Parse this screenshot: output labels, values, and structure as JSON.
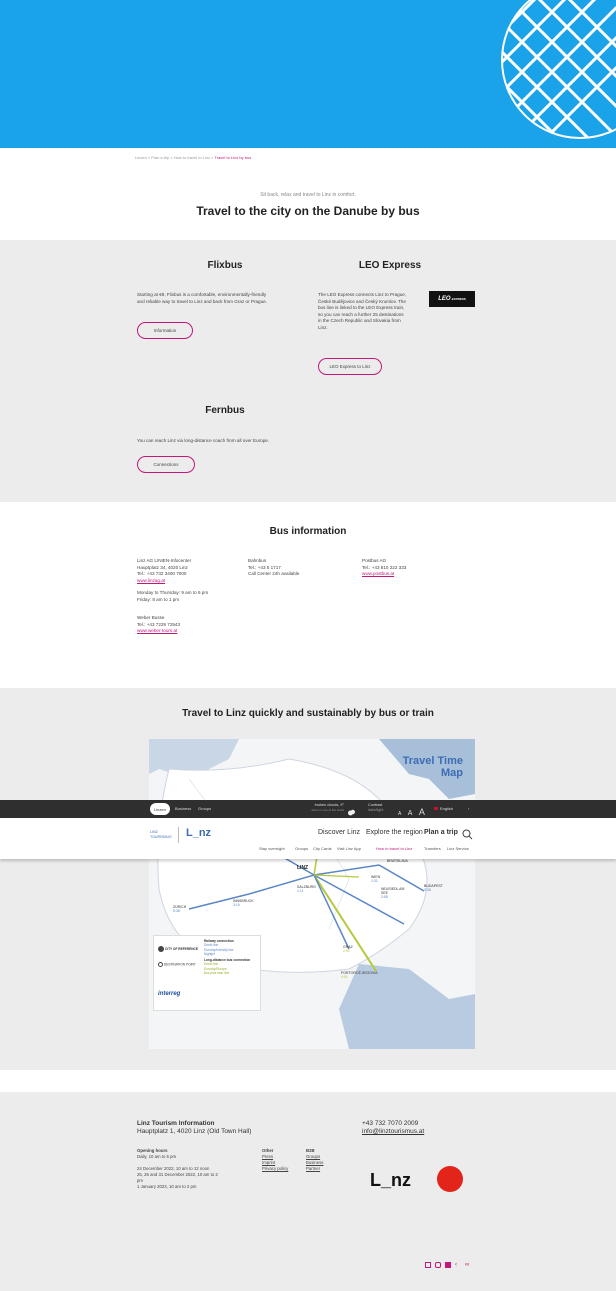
{
  "breadcrumb": {
    "items": [
      "Linzen",
      "Plan a trip",
      "How to travel to Linz"
    ],
    "sep": "»",
    "current": "Travel to Linz by bus"
  },
  "intro": {
    "kicker": "Sit back, relax and travel to Linz in comfort.",
    "title": "Travel to the city on the Danube by bus"
  },
  "flixbus": {
    "title": "Flixbus",
    "text": [
      "Starting at €9, Flixbus is a comfortable, environmentally-friendly",
      "and reliable way to travel to Linz and back from Graz or Prague."
    ],
    "button": "Information"
  },
  "leo": {
    "title": "LEO Express",
    "text": [
      "The LEO Express connects Linz to Prague,",
      "České Budějovice and Český Krumlov. The",
      "bus line is linked to the LEO Express train,",
      "so you can reach a further 25 destinations",
      "in the Czech Republic and Slovakia from",
      "Linz."
    ],
    "button": "LEO Express to Linz",
    "logo": "LEO",
    "logo_small": "EXPRESS"
  },
  "fernbus": {
    "title": "Fernbus",
    "text": "You can reach Linz via long-distance coach from all over Europe.",
    "button": "Connections"
  },
  "bus_info": {
    "title": "Bus information",
    "col1": {
      "lines": [
        "Linz AG LINIEN-Infocenter",
        "Hauptplatz 34, 4020 Linz",
        "Tel.: +43 732 3400 7000"
      ],
      "link": "www.linzag.at",
      "hours": [
        "Monday to Thursday: 9 am to 6 pm",
        "Friday: 8 am to 1 pm"
      ],
      "lines2": [
        "Weber Busse",
        "Tel.: +43 7229 72943"
      ],
      "link2": "www.weber-tours.at"
    },
    "col2": {
      "lines": [
        "Bahnbus",
        "Tel.: +43 5 1717",
        "Call Center 24h available"
      ]
    },
    "col3": {
      "lines": [
        "Postbus AG",
        "Tel.: +43 810 222 333"
      ],
      "link": "www.postbus.at"
    }
  },
  "map_section": {
    "title": "Travel to Linz quickly and sustainably by bus or train",
    "map_title_1": "Travel Time",
    "map_title_2": "Map",
    "cities": [
      {
        "name": "FRANKFURT",
        "time": "3:49"
      },
      {
        "name": "PRAGUE",
        "time": "3:31"
      },
      {
        "name": "LINZ",
        "time": ""
      },
      {
        "name": "ZÜRICH",
        "time": "8:38"
      },
      {
        "name": "INNSBRUCK",
        "time": "3:19"
      },
      {
        "name": "SALZBURG",
        "time": "1:11"
      },
      {
        "name": "GRAZ",
        "time": "2:51"
      },
      {
        "name": "BRATISLAVA",
        "time": ""
      },
      {
        "name": "BUDAPEST",
        "time": "3:36"
      },
      {
        "name": "NEUSIEDL AM SEE",
        "time": "2:58"
      },
      {
        "name": "PORTOROŽ-SEGOVIA",
        "time": "4:51"
      },
      {
        "name": "WIEN",
        "time": "1:31"
      }
    ],
    "legend": {
      "city_label": "CITY OF REFERENCE",
      "station_label": "DESTINATION POINT",
      "rail_title": "Railway connection",
      "rail_items": [
        "Direct line",
        "Eurocity/Intercity line",
        "Nightjet"
      ],
      "bus_title": "Long-distance bus connection",
      "bus_items": [
        "Direct line",
        "Eurocity/Europe",
        "Bus plus train line"
      ],
      "brand": "interreg"
    }
  },
  "topbar": {
    "items": [
      "Linzen",
      "Business",
      "Groups"
    ],
    "weather": "broken clouds, 9°",
    "weather_sub": "when in one of the world",
    "contrast": "Contrast",
    "contrast_sub": "dark/light",
    "font_sizes": [
      "A",
      "A",
      "A"
    ],
    "language": "English"
  },
  "navbar": {
    "logo_left": "LINZ TOURISMUS",
    "logo_right": "L_nz",
    "main": [
      "Discover Linz",
      "Explore the region",
      "Plan a trip"
    ],
    "sub": [
      "Stay overnight",
      "Groups",
      "City Cards",
      "Visit Linz App",
      "How to travel to Linz",
      "Transfers",
      "Linz Service"
    ]
  },
  "footer": {
    "title": "Linz Tourism Information",
    "address": "Hauptplatz 1, 4020 Linz (Old Town Hall)",
    "phone": "+43 732 7070 2009",
    "email": "info@linztourismus.at",
    "hours_title": "Opening hours",
    "hours": [
      "Daily, 10 am to 5 pm",
      "",
      "24 December 2022, 10 am to 12 noon",
      "25, 26 and 31 December 2022, 10 am to 2",
      "pm",
      "1 January 2023, 10 am to 2 pm"
    ],
    "other_title": "Other",
    "other": [
      "Press",
      "Imprint",
      "Privacy policy"
    ],
    "b2b_title": "B2B",
    "b2b": [
      "Groups",
      "Business",
      "Partner"
    ],
    "logo": "L_nz",
    "social": [
      "facebook-icon",
      "instagram-icon",
      "youtube-icon",
      "twitter-icon",
      "flickr-icon"
    ]
  },
  "colors": {
    "accent": "#c2187c",
    "hero": "#1aa3e8",
    "grey": "#ececec",
    "topbar": "#2f2f2f"
  }
}
